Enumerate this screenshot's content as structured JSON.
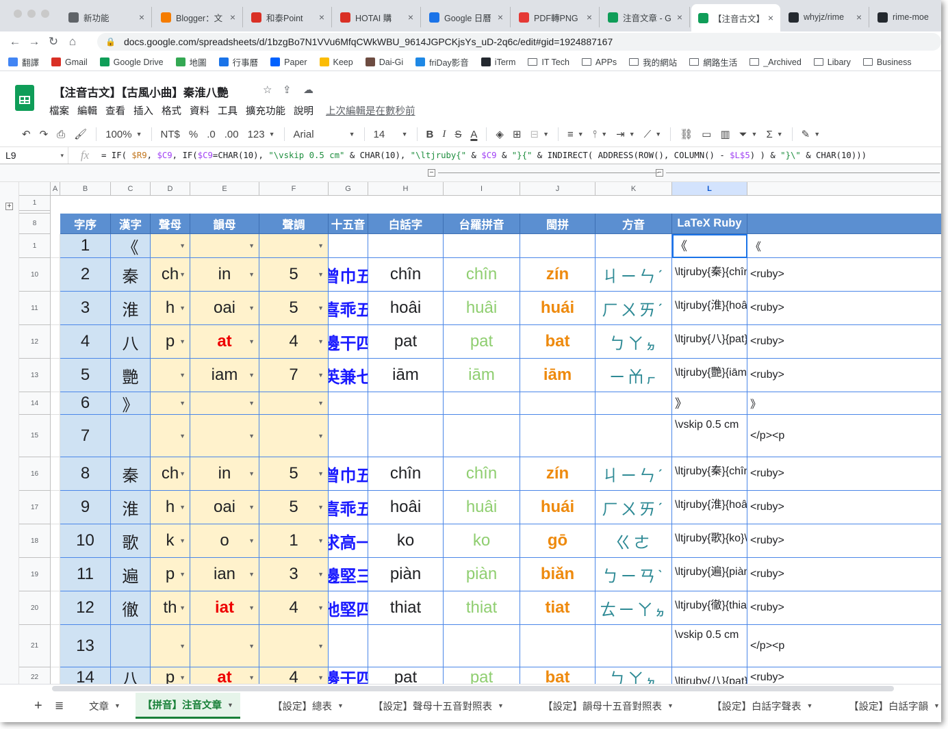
{
  "browser": {
    "tabs": [
      {
        "title": "新功能",
        "icon": "chrome-icon",
        "color": "#5f6368"
      },
      {
        "title": "Blogger：文",
        "icon": "blogger-icon",
        "color": "#f57c00"
      },
      {
        "title": "和泰Point",
        "icon": "gmail-icon",
        "color": "#d93025"
      },
      {
        "title": "HOTAI 購",
        "icon": "hotai-icon",
        "color": "#d93025"
      },
      {
        "title": "Google 日曆",
        "icon": "calendar-icon",
        "color": "#1a73e8"
      },
      {
        "title": "PDF轉PNG",
        "icon": "pdf-icon",
        "color": "#e53935"
      },
      {
        "title": "注音文章 - G",
        "icon": "drive-icon",
        "color": "#0f9d58"
      },
      {
        "title": "【注音古文】",
        "icon": "sheets-icon",
        "color": "#0f9d58"
      },
      {
        "title": "whyjz/rime",
        "icon": "github-icon",
        "color": "#24292f"
      },
      {
        "title": "rime-moe",
        "icon": "github-icon",
        "color": "#24292f"
      }
    ],
    "url": "docs.google.com/spreadsheets/d/1bzgBo7N1VVu6MfqCWkWBU_9614JGPCKjsYs_uD-2q6c/edit#gid=1924887167",
    "bookmarks": [
      {
        "label": "翻譯",
        "color": "#4285f4",
        "folder": false
      },
      {
        "label": "Gmail",
        "color": "#d93025",
        "folder": false
      },
      {
        "label": "Google Drive",
        "color": "#0f9d58",
        "folder": false
      },
      {
        "label": "地圖",
        "color": "#34a853",
        "folder": false
      },
      {
        "label": "行事曆",
        "color": "#1a73e8",
        "folder": false
      },
      {
        "label": "Paper",
        "color": "#0061fe",
        "folder": false
      },
      {
        "label": "Keep",
        "color": "#fbbc04",
        "folder": false
      },
      {
        "label": "Dai-Gi",
        "color": "#6d4c41",
        "folder": false
      },
      {
        "label": "friDay影音",
        "color": "#1e88e5",
        "folder": false
      },
      {
        "label": "iTerm",
        "color": "#24292f",
        "folder": false
      },
      {
        "label": "IT Tech",
        "color": "",
        "folder": true
      },
      {
        "label": "APPs",
        "color": "",
        "folder": true
      },
      {
        "label": "我的網站",
        "color": "",
        "folder": true
      },
      {
        "label": "網路生活",
        "color": "",
        "folder": true
      },
      {
        "label": "_Archived",
        "color": "",
        "folder": true
      },
      {
        "label": "Libary",
        "color": "",
        "folder": true
      },
      {
        "label": "Business",
        "color": "",
        "folder": true
      }
    ]
  },
  "doc": {
    "title": "【注音古文】【古風小曲】秦淮八艷",
    "menus": [
      "檔案",
      "編輯",
      "查看",
      "插入",
      "格式",
      "資料",
      "工具",
      "擴充功能",
      "說明"
    ],
    "last_edit": "上次編輯是在數秒前"
  },
  "toolbar": {
    "zoom": "100%",
    "currency": "NT$",
    "percent": "%",
    "dec_less": ".0",
    "dec_more": ".00",
    "format_more": "123",
    "font": "Arial",
    "font_size": "14",
    "bold": "B",
    "italic": "I",
    "strike": "S",
    "text_color": "A"
  },
  "formula": {
    "cell": "L9",
    "fx": "fx",
    "parts": [
      {
        "t": "= IF( ",
        "c": ""
      },
      {
        "t": "$R9",
        "c": "fa"
      },
      {
        "t": ", ",
        "c": ""
      },
      {
        "t": "$C9",
        "c": "fb"
      },
      {
        "t": ", IF(",
        "c": ""
      },
      {
        "t": "$C9",
        "c": "fb"
      },
      {
        "t": "=CHAR(10), ",
        "c": ""
      },
      {
        "t": "\"\\vskip 0.5 cm\"",
        "c": "fe"
      },
      {
        "t": " & CHAR(10), ",
        "c": ""
      },
      {
        "t": "\"\\ltjruby{\"",
        "c": "fe"
      },
      {
        "t": " & ",
        "c": ""
      },
      {
        "t": "$C9",
        "c": "fb"
      },
      {
        "t": " & ",
        "c": ""
      },
      {
        "t": "\"}{\"",
        "c": "fe"
      },
      {
        "t": " & INDIRECT( ADDRESS(ROW(), COLUMN() - ",
        "c": ""
      },
      {
        "t": "$L$5",
        "c": "fb"
      },
      {
        "t": ") ) & ",
        "c": ""
      },
      {
        "t": "\"}\\\"",
        "c": "fe"
      },
      {
        "t": " & CHAR(10)))",
        "c": ""
      }
    ]
  },
  "columns": [
    "A",
    "B",
    "C",
    "D",
    "E",
    "F",
    "G",
    "H",
    "I",
    "J",
    "K",
    "L",
    ""
  ],
  "selected_cell": "L9",
  "headers": [
    "字序",
    "漢字",
    "聲母",
    "韻母",
    "聲調",
    "十五音",
    "白話字",
    "台羅拼音",
    "閩拼",
    "方音",
    "LaTeX Ruby",
    ""
  ],
  "rows": [
    {
      "n": "1",
      "idx": "1",
      "hanzi": "《",
      "sm": "",
      "ym": "",
      "sd": "",
      "sw": "",
      "bh": "",
      "tl": "",
      "mp": "",
      "fy": "",
      "latex": "《",
      "html": "《"
    },
    {
      "n": "2",
      "idx": "10",
      "hanzi": "秦",
      "sm": "ch",
      "ym": "in",
      "sd": "5",
      "sw": "曾巾五",
      "bh": "chîn",
      "tl": "chîn",
      "mp": "zín",
      "fy": "ㄐㄧㄣˊ",
      "latex": "\\ltjruby{秦}{chîn}\\",
      "html": "<ruby>"
    },
    {
      "n": "3",
      "idx": "11",
      "hanzi": "淮",
      "sm": "h",
      "ym": "oai",
      "sd": "5",
      "sw": "喜乖五",
      "bh": "hoâi",
      "tl": "huâi",
      "mp": "huái",
      "fy": "ㄏㄨㄞˊ",
      "latex": "\\ltjruby{淮}{hoâi}\\",
      "html": "<ruby>"
    },
    {
      "n": "4",
      "idx": "12",
      "hanzi": "八",
      "sm": "p",
      "ym": "at",
      "sd": "4",
      "sw": "邊干四",
      "bh": "pat",
      "tl": "pat",
      "mp": "bat",
      "fy": "ㄅㄚㆵ",
      "latex": "\\ltjruby{八}{pat}\\",
      "html": "<ruby>",
      "ymred": true
    },
    {
      "n": "5",
      "idx": "13",
      "hanzi": "艷",
      "sm": "",
      "ym": "iam",
      "sd": "7",
      "sw": "英兼七",
      "bh": "iām",
      "tl": "iām",
      "mp": "iām",
      "fy": "ㄧㆰㆷ",
      "latex": "\\ltjruby{艷}{iām}\\",
      "html": "<ruby>"
    },
    {
      "n": "6",
      "idx": "14",
      "hanzi": "》",
      "sm": "",
      "ym": "",
      "sd": "",
      "sw": "",
      "bh": "",
      "tl": "",
      "mp": "",
      "fy": "",
      "latex": "》",
      "html": "》"
    },
    {
      "n": "7",
      "idx": "15",
      "hanzi": "",
      "sm": "",
      "ym": "",
      "sd": "",
      "sw": "",
      "bh": "",
      "tl": "",
      "mp": "",
      "fy": "",
      "latex": "\\vskip 0.5 cm",
      "html": "</p><p"
    },
    {
      "n": "8",
      "idx": "16",
      "hanzi": "秦",
      "sm": "ch",
      "ym": "in",
      "sd": "5",
      "sw": "曾巾五",
      "bh": "chîn",
      "tl": "chîn",
      "mp": "zín",
      "fy": "ㄐㄧㄣˊ",
      "latex": "\\ltjruby{秦}{chîn}\\",
      "html": "<ruby>"
    },
    {
      "n": "9",
      "idx": "17",
      "hanzi": "淮",
      "sm": "h",
      "ym": "oai",
      "sd": "5",
      "sw": "喜乖五",
      "bh": "hoâi",
      "tl": "huâi",
      "mp": "huái",
      "fy": "ㄏㄨㄞˊ",
      "latex": "\\ltjruby{淮}{hoâi}\\",
      "html": "<ruby>"
    },
    {
      "n": "10",
      "idx": "18",
      "hanzi": "歌",
      "sm": "k",
      "ym": "o",
      "sd": "1",
      "sw": "求高一",
      "bh": "ko",
      "tl": "ko",
      "mp": "gō",
      "fy": "ㄍㄜ",
      "latex": "\\ltjruby{歌}{ko}\\",
      "html": "<ruby>"
    },
    {
      "n": "11",
      "idx": "19",
      "hanzi": "遍",
      "sm": "p",
      "ym": "ian",
      "sd": "3",
      "sw": "邊堅三",
      "bh": "piàn",
      "tl": "piàn",
      "mp": "biǎn",
      "fy": "ㄅㄧㄢˋ",
      "latex": "\\ltjruby{遍}{piàn}\\",
      "html": "<ruby>"
    },
    {
      "n": "12",
      "idx": "20",
      "hanzi": "徹",
      "sm": "th",
      "ym": "iat",
      "sd": "4",
      "sw": "他堅四",
      "bh": "thiat",
      "tl": "thiat",
      "mp": "tiat",
      "fy": "ㄊㄧㄚㆵ",
      "latex": "\\ltjruby{徹}{thiat}\\",
      "html": "<ruby>",
      "ymred": true
    },
    {
      "n": "13",
      "idx": "21",
      "hanzi": "",
      "sm": "",
      "ym": "",
      "sd": "",
      "sw": "",
      "bh": "",
      "tl": "",
      "mp": "",
      "fy": "",
      "latex": "\\vskip 0.5 cm",
      "html": "</p><p"
    },
    {
      "n": "14",
      "idx": "22",
      "hanzi": "八",
      "sm": "p",
      "ym": "at",
      "sd": "4",
      "sw": "邊干四",
      "bh": "pat",
      "tl": "pat",
      "mp": "bat",
      "fy": "ㄅㄚㆵ",
      "latex": "\\ltjruby{八}{pat}\\",
      "html": "<ruby>",
      "ymred": true
    }
  ],
  "sheets": [
    {
      "label": "文章",
      "active": false
    },
    {
      "label": "【拼音】注音文章",
      "active": true
    },
    {
      "label": "【設定】總表",
      "active": false
    },
    {
      "label": "【設定】聲母十五音對照表",
      "active": false
    },
    {
      "label": "【設定】韻母十五音對照表",
      "active": false
    },
    {
      "label": "【設定】白話字聲表",
      "active": false
    },
    {
      "label": "【設定】白話字韻",
      "active": false
    }
  ]
}
